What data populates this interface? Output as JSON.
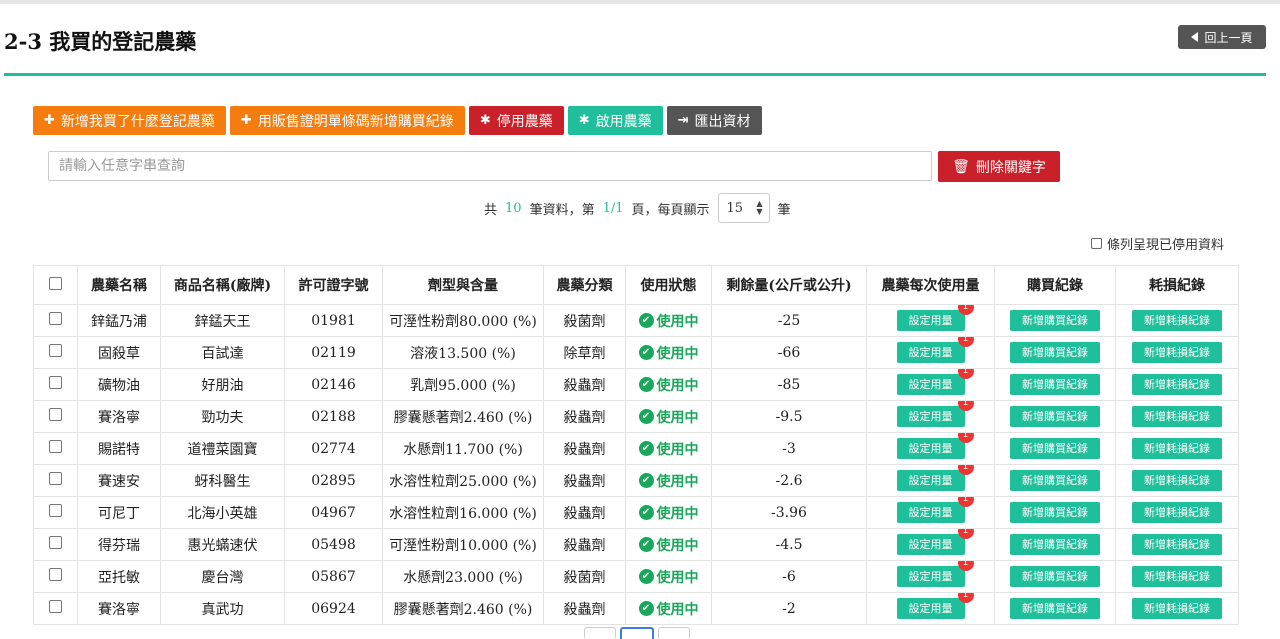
{
  "header": {
    "title": "2-3 我買的登記農藥",
    "back_label": "回上一頁"
  },
  "toolbar": {
    "add_purchase_label": "新增我買了什麼登記農藥",
    "add_by_barcode_label": "用販售證明單條碼新增購買紀錄",
    "disable_label": "停用農藥",
    "enable_label": "啟用農藥",
    "export_label": "匯出資材"
  },
  "search": {
    "placeholder": "請輸入任意字串查詢",
    "value": "",
    "clear_label": "刪除關鍵字"
  },
  "pagination": {
    "prefix": "共",
    "total": "10",
    "mid1": "筆資料，第",
    "page": "1/1",
    "mid2": "頁，每頁顯示",
    "per_page": "15",
    "suffix": "筆"
  },
  "show_disabled_label": "條列呈現已停用資料",
  "table": {
    "columns": [
      "農藥名稱",
      "商品名稱(廠牌)",
      "許可證字號",
      "劑型與含量",
      "農藥分類",
      "使用狀態",
      "剩餘量(公斤或公升)",
      "農藥每次使用量",
      "購買紀錄",
      "耗損紀錄"
    ],
    "set_usage_label": "設定用量",
    "add_purchase_label": "新增購買紀錄",
    "add_loss_label": "新增耗損紀錄",
    "badge_count": "1",
    "rows": [
      {
        "name": "鋅錳乃浦",
        "product": "鋅錳天王",
        "license": "01981",
        "formulation": "可溼性粉劑80.000 (%)",
        "category": "殺菌劑",
        "status": "使用中",
        "remaining": "-25"
      },
      {
        "name": "固殺草",
        "product": "百試達",
        "license": "02119",
        "formulation": "溶液13.500 (%)",
        "category": "除草劑",
        "status": "使用中",
        "remaining": "-66"
      },
      {
        "name": "礦物油",
        "product": "好朋油",
        "license": "02146",
        "formulation": "乳劑95.000 (%)",
        "category": "殺蟲劑",
        "status": "使用中",
        "remaining": "-85"
      },
      {
        "name": "賽洛寧",
        "product": "勁功夫",
        "license": "02188",
        "formulation": "膠囊懸著劑2.460 (%)",
        "category": "殺蟲劑",
        "status": "使用中",
        "remaining": "-9.5"
      },
      {
        "name": "賜諾特",
        "product": "道禮菜園寶",
        "license": "02774",
        "formulation": "水懸劑11.700 (%)",
        "category": "殺蟲劑",
        "status": "使用中",
        "remaining": "-3"
      },
      {
        "name": "賽速安",
        "product": "蚜科醫生",
        "license": "02895",
        "formulation": "水溶性粒劑25.000 (%)",
        "category": "殺蟲劑",
        "status": "使用中",
        "remaining": "-2.6"
      },
      {
        "name": "可尼丁",
        "product": "北海小英雄",
        "license": "04967",
        "formulation": "水溶性粒劑16.000 (%)",
        "category": "殺蟲劑",
        "status": "使用中",
        "remaining": "-3.96"
      },
      {
        "name": "得芬瑞",
        "product": "惠光蟎速伏",
        "license": "05498",
        "formulation": "可溼性粉劑10.000 (%)",
        "category": "殺蟲劑",
        "status": "使用中",
        "remaining": "-4.5"
      },
      {
        "name": "亞托敏",
        "product": "慶台灣",
        "license": "05867",
        "formulation": "水懸劑23.000 (%)",
        "category": "殺菌劑",
        "status": "使用中",
        "remaining": "-6"
      },
      {
        "name": "賽洛寧",
        "product": "真武功",
        "license": "06924",
        "formulation": "膠囊懸著劑2.460 (%)",
        "category": "殺蟲劑",
        "status": "使用中",
        "remaining": "-2"
      }
    ]
  },
  "colors": {
    "accent": "#1fbf9c",
    "orange": "#f57c0e",
    "danger": "#c9202a",
    "dark": "#555555",
    "status_green": "#1aa65b"
  }
}
